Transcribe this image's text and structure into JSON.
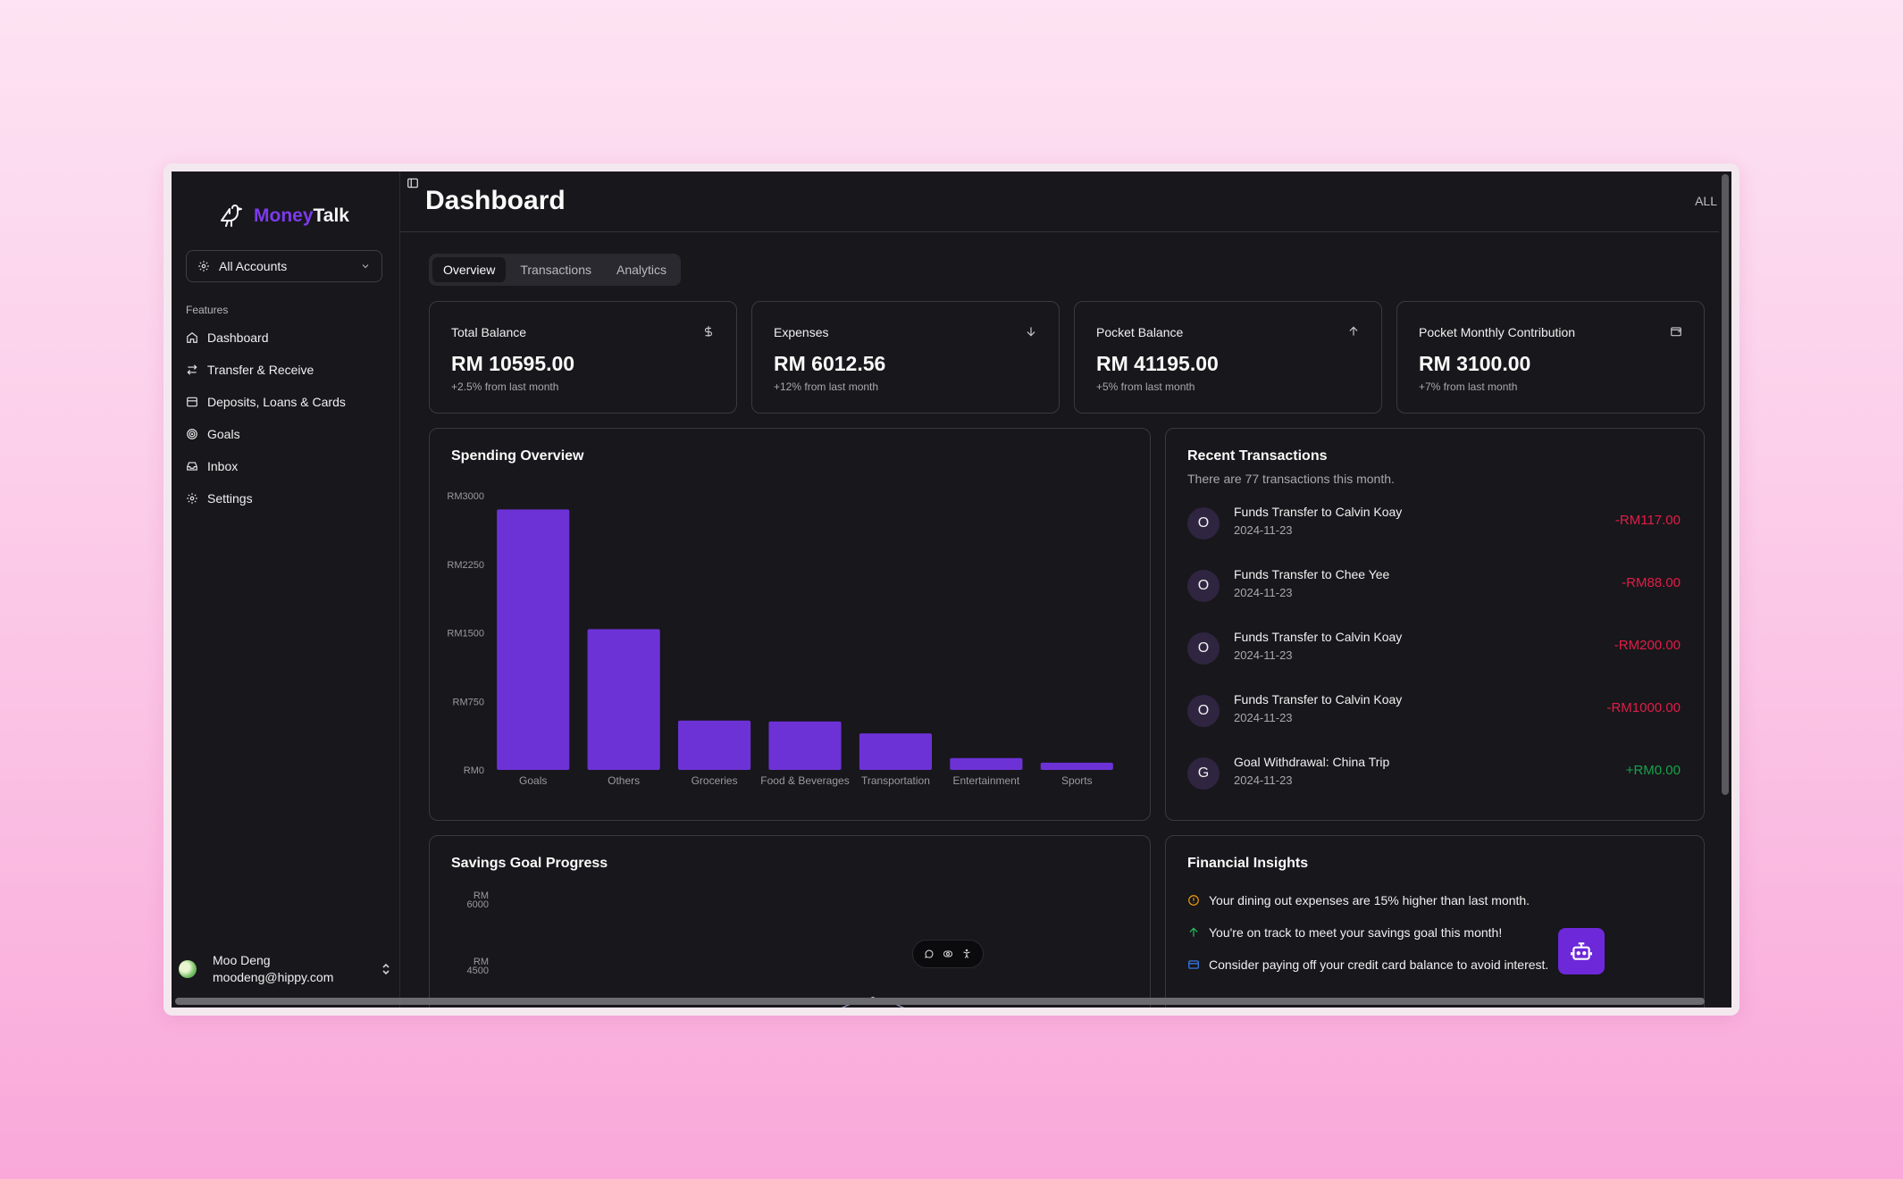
{
  "app": {
    "brand_part1": "Money",
    "brand_part2": "Talk",
    "accent_color": "#6d28d9"
  },
  "sidebar": {
    "account_selector": "All Accounts",
    "section_label": "Features",
    "items": [
      {
        "label": "Dashboard",
        "icon": "home-icon"
      },
      {
        "label": "Transfer & Receive",
        "icon": "arrows-swap-icon"
      },
      {
        "label": "Deposits, Loans & Cards",
        "icon": "card-icon"
      },
      {
        "label": "Goals",
        "icon": "goal-icon"
      },
      {
        "label": "Inbox",
        "icon": "inbox-icon"
      },
      {
        "label": "Settings",
        "icon": "gear-icon"
      }
    ],
    "user": {
      "name": "Moo Deng",
      "email": "moodeng@hippy.com"
    }
  },
  "header": {
    "title": "Dashboard",
    "scope": "ALL"
  },
  "tabs": [
    "Overview",
    "Transactions",
    "Analytics"
  ],
  "stats": [
    {
      "label": "Total Balance",
      "value": "RM 10595.00",
      "sub": "+2.5% from last month",
      "icon": "dollar-icon"
    },
    {
      "label": "Expenses",
      "value": "RM 6012.56",
      "sub": "+12% from last month",
      "icon": "arrow-down-icon"
    },
    {
      "label": "Pocket Balance",
      "value": "RM 41195.00",
      "sub": "+5% from last month",
      "icon": "arrow-up-icon"
    },
    {
      "label": "Pocket Monthly Contribution",
      "value": "RM 3100.00",
      "sub": "+7% from last month",
      "icon": "wallet-icon"
    }
  ],
  "spending": {
    "title": "Spending Overview"
  },
  "chart_data": {
    "type": "bar",
    "title": "Spending Overview",
    "categories": [
      "Goals",
      "Others",
      "Groceries",
      "Food & Beverages",
      "Transportation",
      "Entertainment",
      "Sports"
    ],
    "values": [
      2850,
      1540,
      540,
      530,
      400,
      130,
      80
    ],
    "yticks": [
      "RM0",
      "RM750",
      "RM1500",
      "RM2250",
      "RM3000"
    ],
    "ylim": [
      0,
      3000
    ],
    "color": "#6d32d6",
    "grid": false
  },
  "recent": {
    "title": "Recent Transactions",
    "desc": "There are 77 transactions this month.",
    "items": [
      {
        "initial": "O",
        "name": "Funds Transfer to Calvin Koay",
        "date": "2024-11-23",
        "amount": "-RM117.00",
        "type": "neg"
      },
      {
        "initial": "O",
        "name": "Funds Transfer to Chee Yee",
        "date": "2024-11-23",
        "amount": "-RM88.00",
        "type": "neg"
      },
      {
        "initial": "O",
        "name": "Funds Transfer to Calvin Koay",
        "date": "2024-11-23",
        "amount": "-RM200.00",
        "type": "neg"
      },
      {
        "initial": "O",
        "name": "Funds Transfer to Calvin Koay",
        "date": "2024-11-23",
        "amount": "-RM1000.00",
        "type": "neg"
      },
      {
        "initial": "G",
        "name": "Goal Withdrawal: China Trip",
        "date": "2024-11-23",
        "amount": "+RM0.00",
        "type": "pos"
      }
    ]
  },
  "savings": {
    "title": "Savings Goal Progress",
    "yticks": [
      {
        "top": "RM",
        "bottom": "6000"
      },
      {
        "top": "RM",
        "bottom": "4500"
      }
    ]
  },
  "insights": {
    "title": "Financial Insights",
    "items": [
      {
        "text": "Your dining out expenses are 15% higher than last month.",
        "icon": "alert-circle-icon",
        "color": "#f59e0b"
      },
      {
        "text": "You're on track to meet your savings goal this month!",
        "icon": "arrow-up-icon",
        "color": "#22c55e"
      },
      {
        "text": "Consider paying off your credit card balance to avoid interest.",
        "icon": "credit-card-icon",
        "color": "#3b82f6"
      }
    ]
  }
}
